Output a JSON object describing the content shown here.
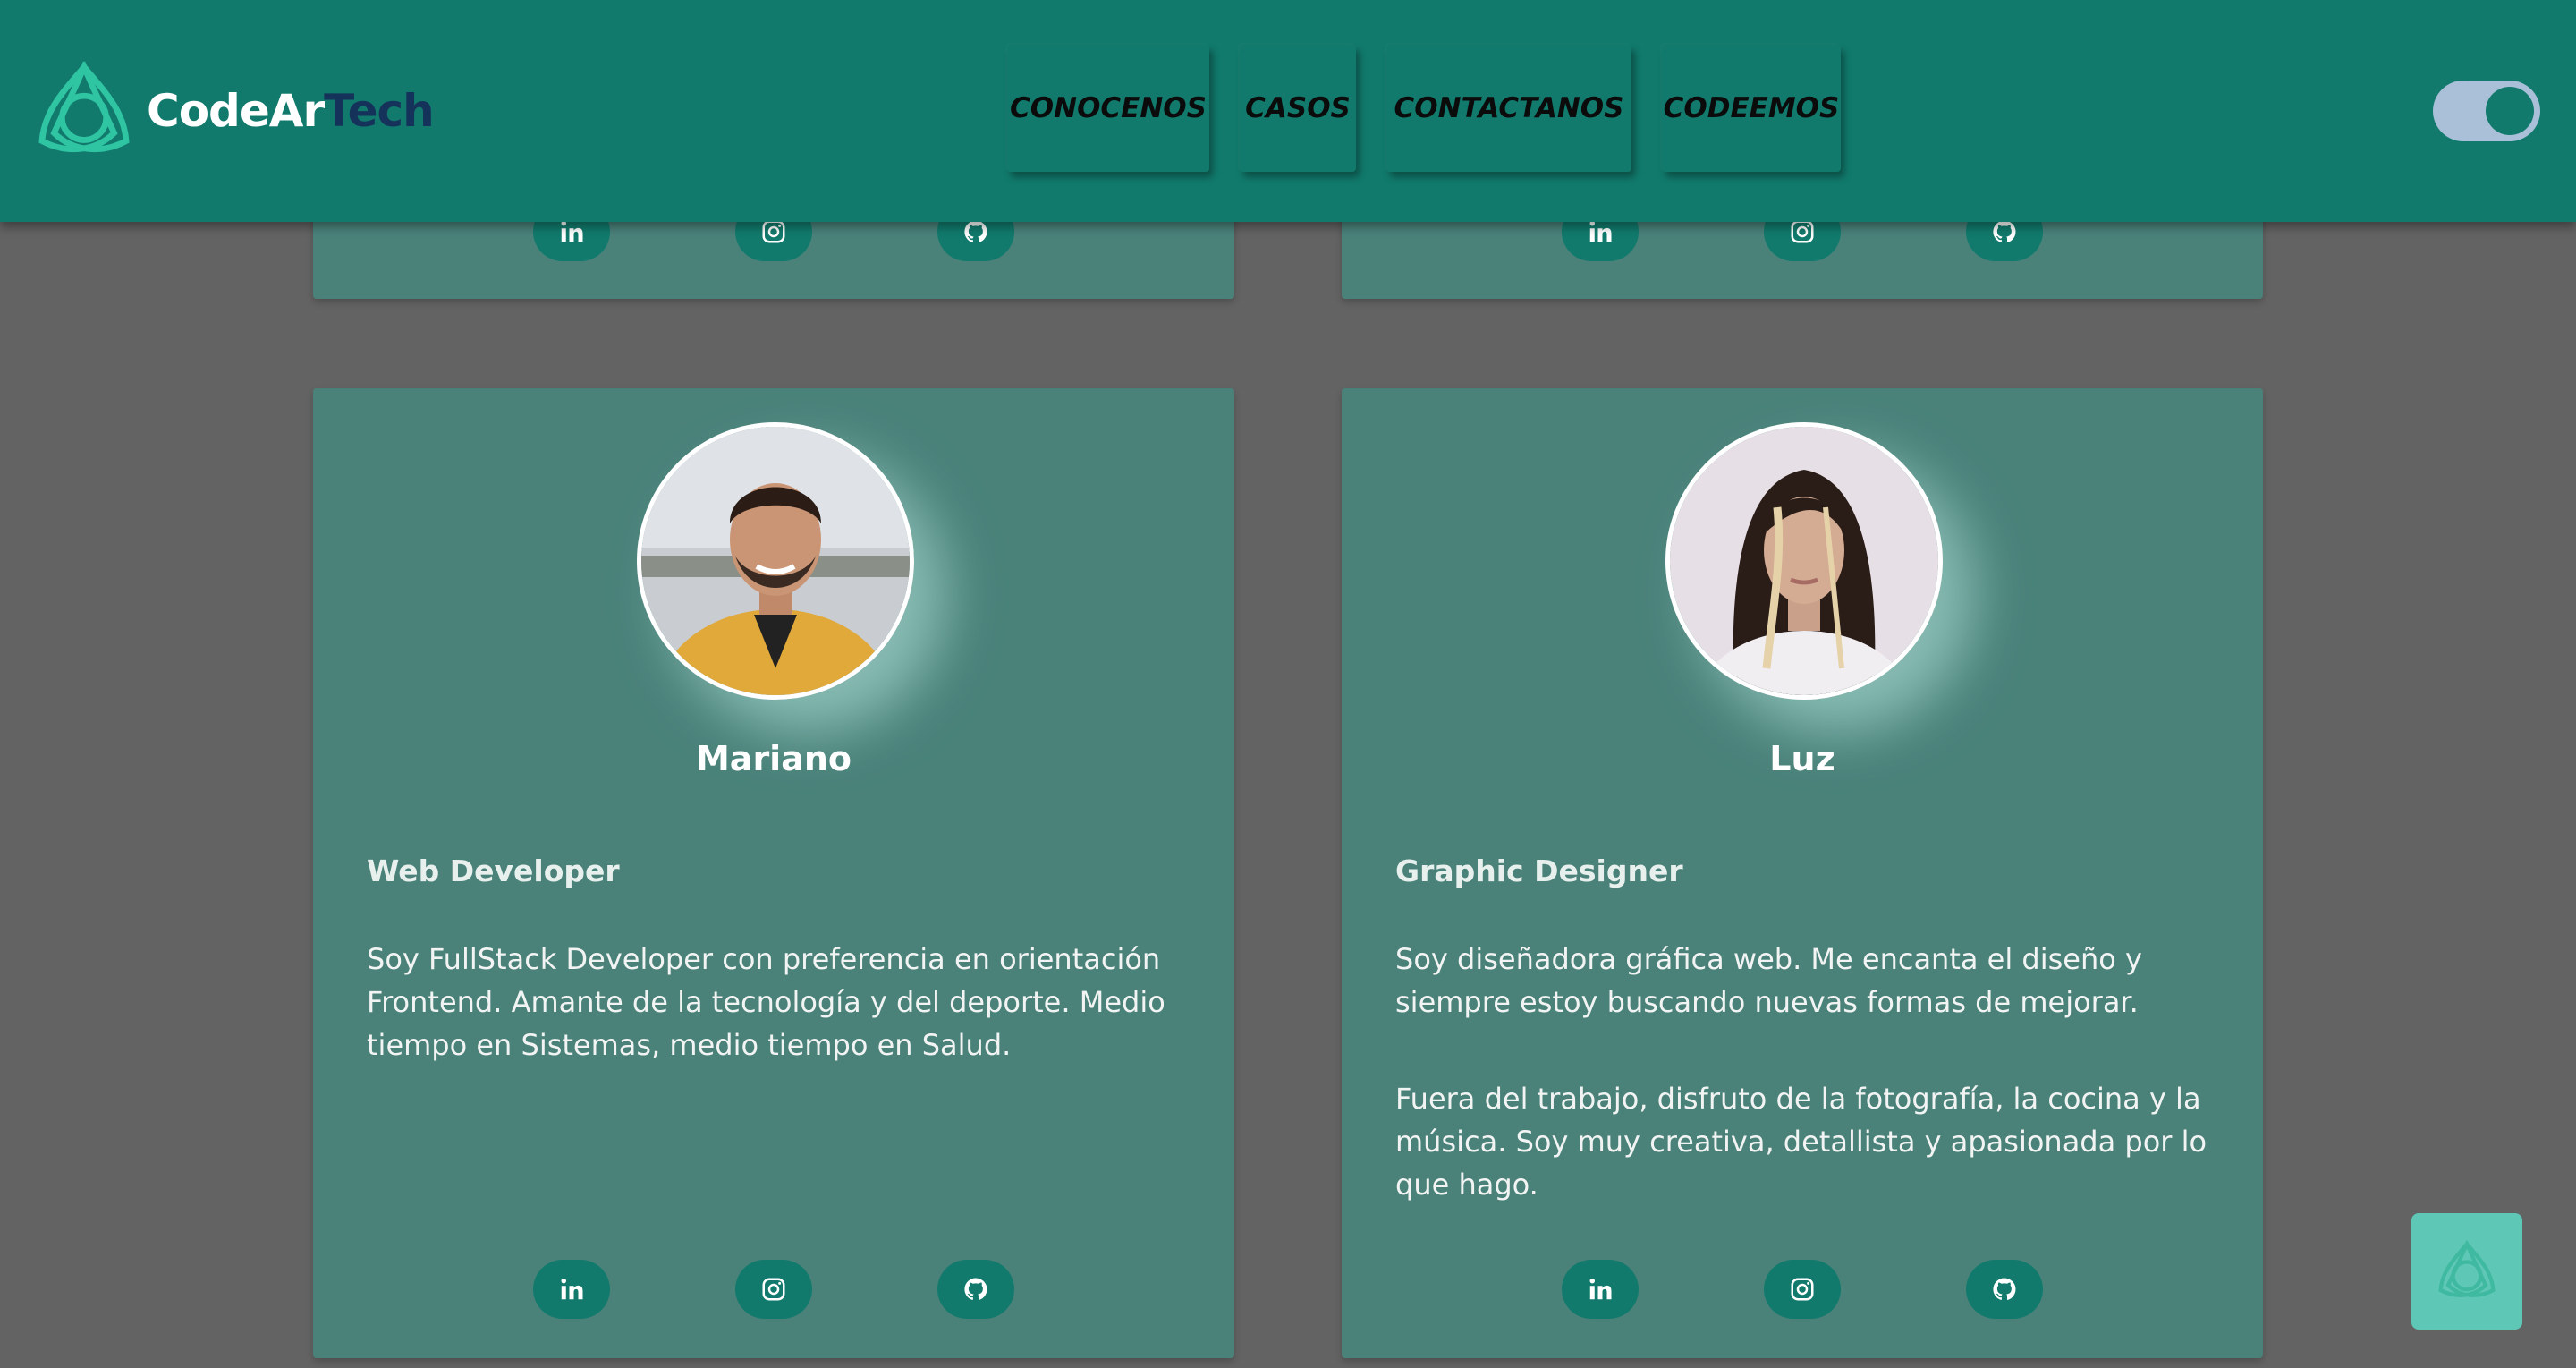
{
  "header": {
    "brand_part1": "CodeAr",
    "brand_part2": "Tech",
    "nav": [
      {
        "label": "CONOCENOS"
      },
      {
        "label": "CASOS"
      },
      {
        "label": "CONTACTANOS"
      },
      {
        "label": "CODEEMOS"
      }
    ],
    "theme_toggle_on": true
  },
  "colors": {
    "header": "#117a6c",
    "card": "#4a827a",
    "page_bg": "#636363",
    "brand_dark": "#15335a",
    "toggle_track": "#a9c0d8",
    "fab": "#5ec7b6"
  },
  "social_icons": [
    "linkedin-icon",
    "instagram-icon",
    "github-icon"
  ],
  "team": [
    {
      "name": "Mariano",
      "role": "Web Developer",
      "bio": [
        "Soy FullStack Developer con preferencia en orientación Frontend. Amante de la tecnología y del deporte. Medio tiempo en Sistemas, medio tiempo en Salud."
      ]
    },
    {
      "name": "Luz",
      "role": "Graphic Designer",
      "bio": [
        "Soy diseñadora gráfica web. Me encanta el diseño y siempre estoy buscando nuevas formas de mejorar.",
        "Fuera del trabajo, disfruto de la fotografía, la cocina y la música. Soy muy creativa, detallista y apasionada por lo que hago."
      ]
    }
  ]
}
